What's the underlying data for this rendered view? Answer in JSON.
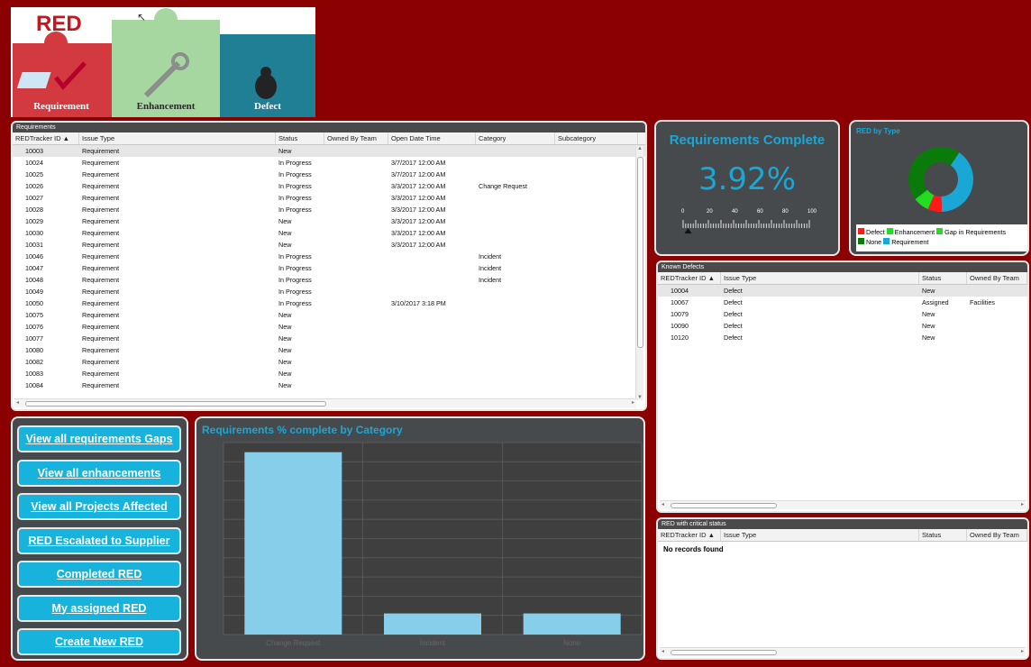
{
  "logo": {
    "brand": "RED",
    "pieces": [
      "Requirement",
      "Enhancement",
      "Defect"
    ],
    "colors": {
      "requirement": "#d8343b",
      "enhancement": "#9fd39a",
      "defect": "#1f7f95"
    }
  },
  "requirements": {
    "title": "Requirements",
    "columns": [
      "REDTracker ID",
      "Issue Type",
      "Status",
      "Owned By Team",
      "Open Date Time",
      "Category",
      "Subcategory"
    ],
    "rows": [
      [
        "10003",
        "Requirement",
        "New",
        "",
        "",
        "",
        ""
      ],
      [
        "10024",
        "Requirement",
        "In Progress",
        "",
        "3/7/2017 12:00 AM",
        "",
        ""
      ],
      [
        "10025",
        "Requirement",
        "In Progress",
        "",
        "3/7/2017 12:00 AM",
        "",
        ""
      ],
      [
        "10026",
        "Requirement",
        "In Progress",
        "",
        "3/3/2017 12:00 AM",
        "Change Request",
        ""
      ],
      [
        "10027",
        "Requirement",
        "In Progress",
        "",
        "3/3/2017 12:00 AM",
        "",
        ""
      ],
      [
        "10028",
        "Requirement",
        "In Progress",
        "",
        "3/3/2017 12:00 AM",
        "",
        ""
      ],
      [
        "10029",
        "Requirement",
        "New",
        "",
        "3/3/2017 12:00 AM",
        "",
        ""
      ],
      [
        "10030",
        "Requirement",
        "New",
        "",
        "3/3/2017 12:00 AM",
        "",
        ""
      ],
      [
        "10031",
        "Requirement",
        "New",
        "",
        "3/3/2017 12:00 AM",
        "",
        ""
      ],
      [
        "10046",
        "Requirement",
        "In Progress",
        "",
        "",
        "Incident",
        ""
      ],
      [
        "10047",
        "Requirement",
        "In Progress",
        "",
        "",
        "Incident",
        ""
      ],
      [
        "10048",
        "Requirement",
        "In Progress",
        "",
        "",
        "Incident",
        ""
      ],
      [
        "10049",
        "Requirement",
        "In Progress",
        "",
        "",
        "",
        ""
      ],
      [
        "10050",
        "Requirement",
        "In Progress",
        "",
        "3/10/2017 3:18 PM",
        "",
        ""
      ],
      [
        "10075",
        "Requirement",
        "New",
        "",
        "",
        "",
        ""
      ],
      [
        "10076",
        "Requirement",
        "New",
        "",
        "",
        "",
        ""
      ],
      [
        "10077",
        "Requirement",
        "New",
        "",
        "",
        "",
        ""
      ],
      [
        "10080",
        "Requirement",
        "New",
        "",
        "",
        "",
        ""
      ],
      [
        "10082",
        "Requirement",
        "New",
        "",
        "",
        "",
        ""
      ],
      [
        "10083",
        "Requirement",
        "New",
        "",
        "",
        "",
        ""
      ],
      [
        "10084",
        "Requirement",
        "New",
        "",
        "",
        "",
        ""
      ]
    ]
  },
  "completion": {
    "title": "Requirements Complete",
    "value": "3.92%",
    "percent": 3.92,
    "scale_labels": [
      "0",
      "20",
      "40",
      "60",
      "80",
      "100"
    ]
  },
  "red_by_type": {
    "title": "RED by Type",
    "legend": [
      {
        "label": "Defect",
        "color": "#ff1a1a"
      },
      {
        "label": "Enhancement",
        "color": "#22dd22"
      },
      {
        "label": "Gap in Requirements",
        "color": "#22dd22"
      },
      {
        "label": "None",
        "color": "#0a7a0a"
      },
      {
        "label": "Requirement",
        "color": "#1aa7d6"
      }
    ]
  },
  "chart_data": {
    "type": "pie",
    "title": "RED by Type",
    "labels": [
      "Requirement",
      "Defect",
      "Enhancement",
      "Gap in Requirements",
      "None"
    ],
    "values": [
      40,
      7,
      7,
      1,
      45
    ],
    "colors": [
      "#1aa7d6",
      "#ff1a1a",
      "#22dd22",
      "#22dd22",
      "#0a7a0a"
    ],
    "donut": true
  },
  "category_chart": {
    "title": "Requirements % complete by Category",
    "type": "bar",
    "categories": [
      "Change Request",
      "Incident",
      "None"
    ],
    "values": [
      95,
      11,
      11
    ],
    "ylim": [
      0,
      100
    ],
    "bar_color": "#87ceeb"
  },
  "known_defects": {
    "title": "Known Defects",
    "columns": [
      "REDTracker ID",
      "Issue Type",
      "Status",
      "Owned By Team"
    ],
    "rows": [
      [
        "10004",
        "Defect",
        "New",
        ""
      ],
      [
        "10067",
        "Defect",
        "Assigned",
        "Facilities"
      ],
      [
        "10079",
        "Defect",
        "New",
        ""
      ],
      [
        "10090",
        "Defect",
        "New",
        ""
      ],
      [
        "10120",
        "Defect",
        "New",
        ""
      ]
    ]
  },
  "critical": {
    "title": "RED with critical status",
    "columns": [
      "REDTracker ID",
      "Issue Type",
      "Status",
      "Owned By Team"
    ],
    "empty_text": "No records found"
  },
  "buttons": [
    "View all requirements Gaps",
    "View all enhancements",
    "View all Projects Affected",
    "RED Escalated to Supplier",
    "Completed RED",
    "My assigned RED",
    "Create New RED"
  ]
}
